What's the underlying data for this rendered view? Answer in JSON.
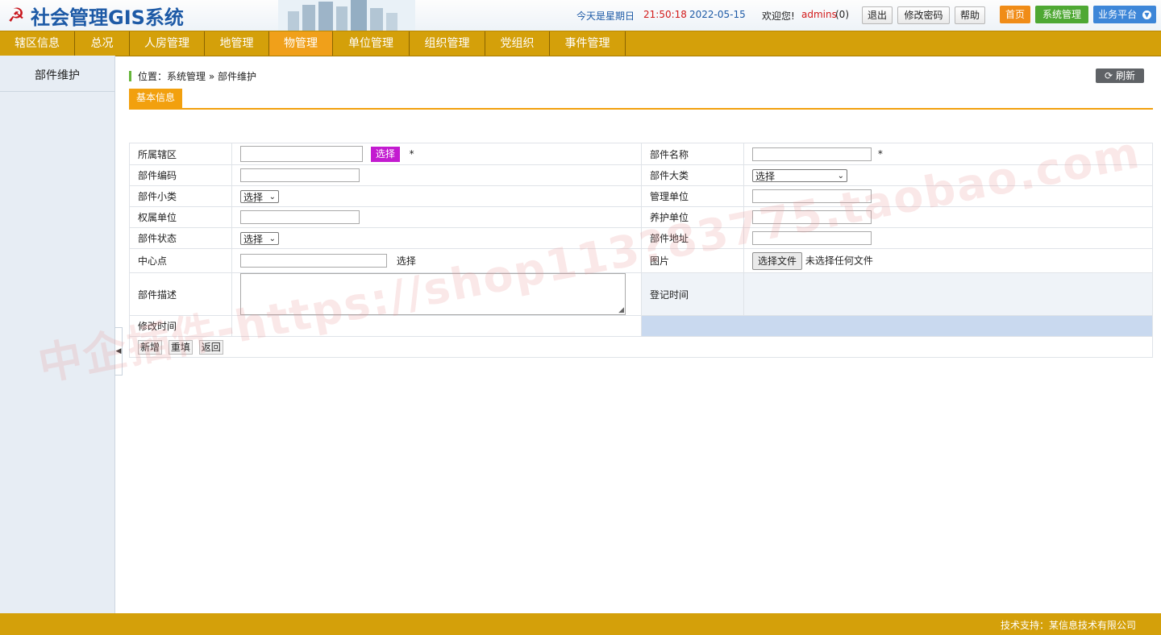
{
  "header": {
    "app_title": "社会管理GIS系统",
    "day_label": "今天是星期日",
    "time": "21:50:18",
    "date": "2022-05-15",
    "welcome": "欢迎您!",
    "user": "admins",
    "count": "(0)",
    "logout": "退出",
    "change_password": "修改密码",
    "help": "帮助",
    "home": "首页",
    "system_manage": "系统管理",
    "business_platform": "业务平台"
  },
  "nav": {
    "items": [
      {
        "label": "辖区信息"
      },
      {
        "label": "总况"
      },
      {
        "label": "人房管理"
      },
      {
        "label": "地管理"
      },
      {
        "label": "物管理"
      },
      {
        "label": "单位管理"
      },
      {
        "label": "组织管理"
      },
      {
        "label": "党组织"
      },
      {
        "label": "事件管理"
      }
    ],
    "active_index": 4
  },
  "sidebar": {
    "items": [
      {
        "label": "部件维护"
      }
    ]
  },
  "main": {
    "breadcrumb": "位置：系统管理 » 部件维护",
    "refresh": "刷新",
    "tab": "基本信息",
    "required_mark": "*",
    "form": {
      "district_label": "所属辖区",
      "district_pick": "选择",
      "part_name_label": "部件名称",
      "part_code_label": "部件编码",
      "major_category_label": "部件大类",
      "major_category_value": "选择",
      "minor_category_label": "部件小类",
      "minor_category_value": "选择",
      "manage_unit_label": "管理单位",
      "owner_unit_label": "权属单位",
      "maintain_unit_label": "养护单位",
      "status_label": "部件状态",
      "status_value": "选择",
      "address_label": "部件地址",
      "center_label": "中心点",
      "center_pick": "选择",
      "picture_label": "图片",
      "file_button": "选择文件",
      "file_status": "未选择任何文件",
      "desc_label": "部件描述",
      "register_time_label": "登记时间",
      "modify_time_label": "修改时间"
    },
    "actions": {
      "add": "新增",
      "reset": "重填",
      "back": "返回"
    }
  },
  "footer": {
    "support": "技术支持：某信息技术有限公司"
  },
  "watermark": "中企插件-https://shop113?83775.taobao.com",
  "colors": {
    "nav_bg": "#d4a00a",
    "nav_active": "#f0a01a",
    "pick_button": "#c31bd0",
    "title_blue": "#1d5aa6",
    "time_red": "#d21a1a",
    "home_orange": "#f08c17",
    "system_green": "#4ea833",
    "platform_blue": "#3d86d8"
  }
}
